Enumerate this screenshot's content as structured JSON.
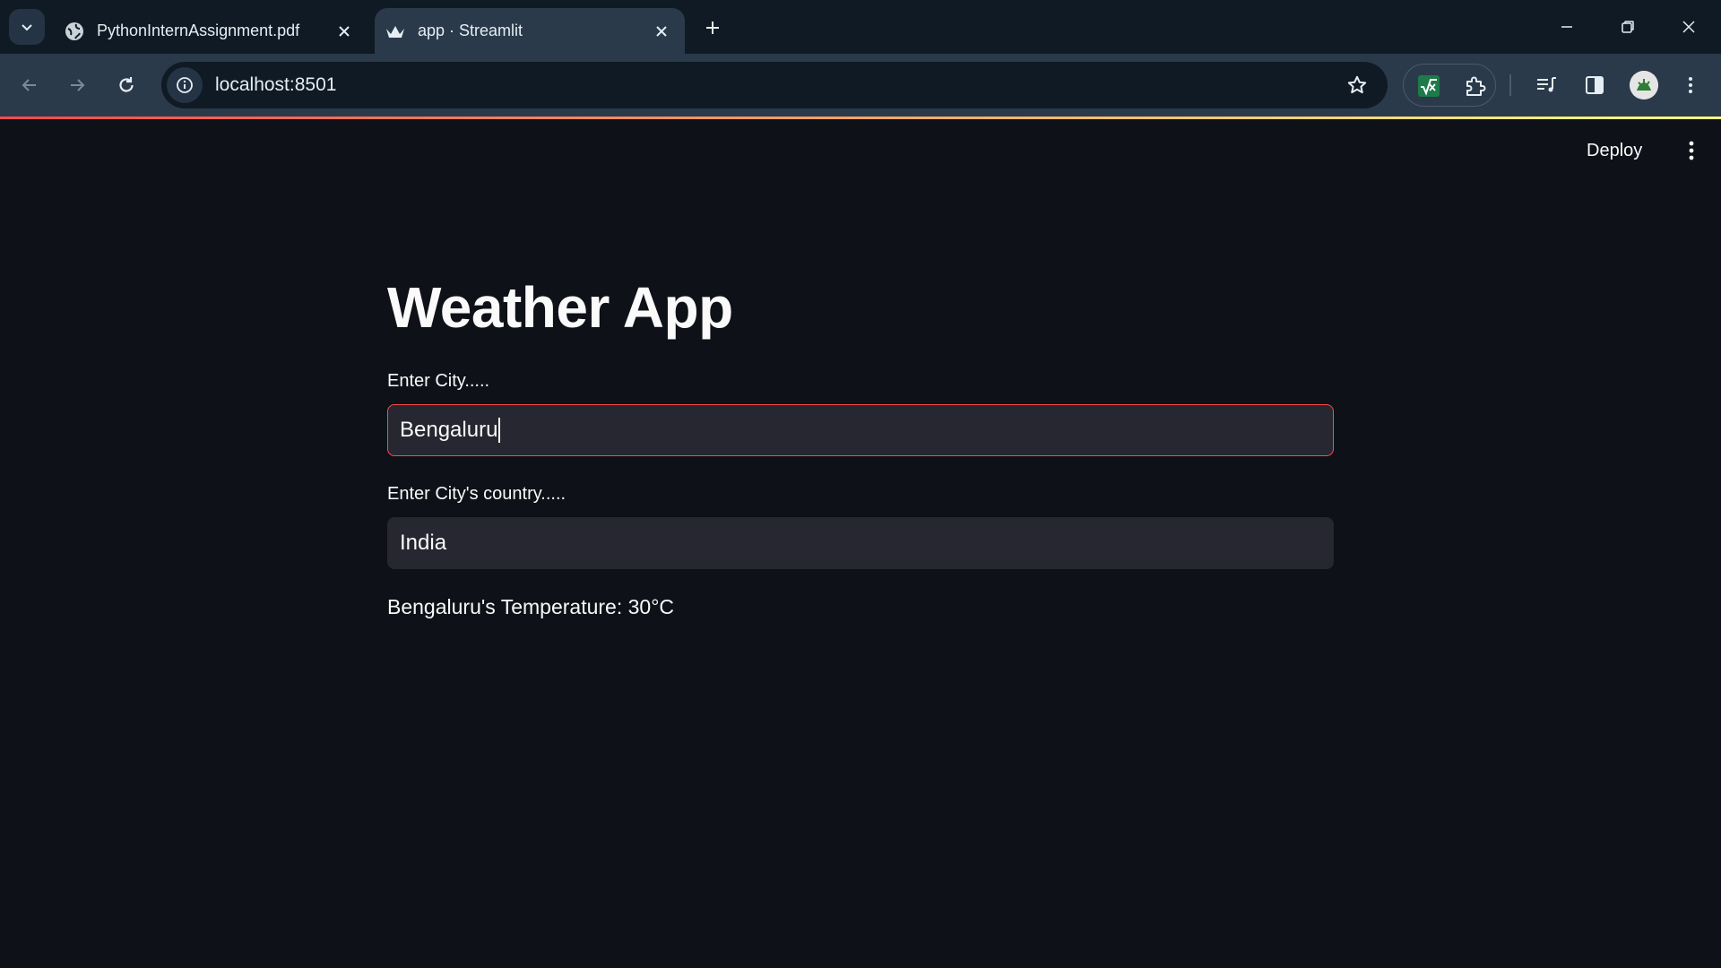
{
  "browser": {
    "tabs": [
      {
        "title": "PythonInternAssignment.pdf",
        "favicon": "globe-icon",
        "active": false
      },
      {
        "title": "app · Streamlit",
        "favicon": "streamlit-crown-icon",
        "active": true
      }
    ],
    "url": "localhost:8501",
    "accent_gradient": [
      "#ff4b4b",
      "#fffd80"
    ]
  },
  "app": {
    "deploy_label": "Deploy",
    "title": "Weather App",
    "city_label": "Enter City.....",
    "city_value": "Bengaluru",
    "country_label": "Enter City's country.....",
    "country_value": "India",
    "result": "Bengaluru's Temperature: 30°C"
  },
  "colors": {
    "background": "#0e1117",
    "input_bg": "#262730",
    "focus_border": "#ff4b4b",
    "text": "#fafafa"
  }
}
